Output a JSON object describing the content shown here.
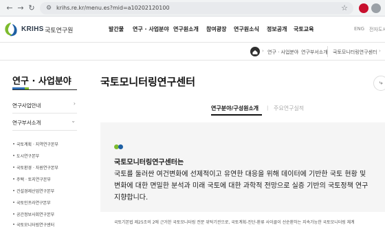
{
  "browser": {
    "url": "krihs.re.kr/menu.es?mid=a10202120100",
    "colors": {
      "chrome_bg": "#f1f3f4",
      "url_bg": "#e8eaed"
    }
  },
  "header": {
    "logo_en": "KRIHS",
    "logo_ko": "국토연구원",
    "nav": [
      "발간물",
      "연구 · 사업분야",
      "연구원소개",
      "참여광장",
      "연구원소식",
      "정보공개",
      "국토교육"
    ],
    "util": [
      "ENG",
      "전자도서"
    ]
  },
  "breadcrumb": [
    "연구 · 사업분야",
    "연구부서소개",
    "국토모니터링연구센터"
  ],
  "sidebar": {
    "title": "연구 · 사업분야",
    "items": [
      {
        "label": "연구사업안내",
        "icon": "chevron-right-icon"
      },
      {
        "label": "연구부서소개",
        "icon": "chevron-down-icon"
      }
    ],
    "sub_items": [
      "국토계획 · 지역연구본부",
      "도시연구본부",
      "국토환경 · 자원연구본부",
      "주택 · 토지연구본부",
      "건설경제산업연구본부",
      "국토인프라연구본부",
      "공간정보사회연구본부",
      "국토모니터링연구센터"
    ],
    "colors": {
      "accent_blue": "#2e6db4",
      "accent_green": "#7dbb2e"
    }
  },
  "content": {
    "page_title": "국토모니터링연구센터",
    "tabs": [
      {
        "label": "연구분야/구성원소개",
        "active": true
      },
      {
        "label": "주요연구실적",
        "active": false
      }
    ],
    "intro_lines": [
      "국토모니터링연구센터는",
      "국토를 둘러싼 여건변화에 선제적이고 유연한 대응을 위해 데이터에 기반한 국토 현황 및",
      "변화에 대한 면밀한 분석과 미래 국토에 대한 과학적 전망으로 실증 기반의 국토정책 연구",
      "지향합니다."
    ],
    "body_text": "국토기본법 제25조의 2에 근거한 국토모니터링 전문 위탁기관으로, 국토계획-진단-환류 사이클이 선순환하는 지속가능한 국토모니터링 체계",
    "colors": {
      "dot_green": "#7dbb2e",
      "dot_blue": "#1d5fa3",
      "box_bg": "#f5f5f5"
    }
  }
}
